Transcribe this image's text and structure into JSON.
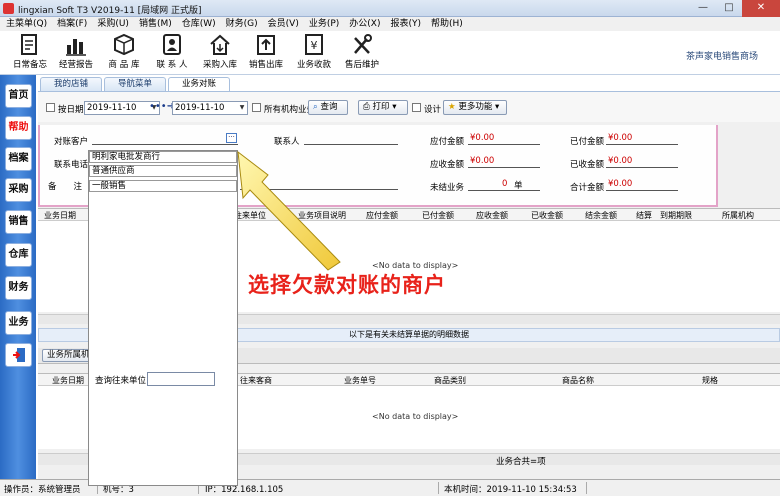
{
  "window": {
    "title": "lingxian Soft T3 V2019-11 [局域网 正式版]",
    "minimize": "—",
    "maximize": "□",
    "close": "✕"
  },
  "menu": [
    "主菜单(Q)",
    "档案(F)",
    "采购(U)",
    "销售(M)",
    "仓库(W)",
    "财务(G)",
    "会员(V)",
    "业务(P)",
    "办公(X)",
    "报表(Y)",
    "帮助(H)"
  ],
  "toolbar": [
    {
      "label": "日常备忘",
      "icon": "memo-icon"
    },
    {
      "label": "经营报告",
      "icon": "bar-chart-icon"
    },
    {
      "label": "商 品 库",
      "icon": "box-icon"
    },
    {
      "label": "联 系 人",
      "icon": "contact-card-icon"
    },
    {
      "label": "采购入库",
      "icon": "house-arrow-icon"
    },
    {
      "label": "销售出库",
      "icon": "upload-icon"
    },
    {
      "label": "业务收款",
      "icon": "yen-doc-icon"
    },
    {
      "label": "售后维护",
      "icon": "tools-icon"
    }
  ],
  "company": "茶声家电销售商场",
  "leftnav": [
    {
      "label": "首页",
      "red": false
    },
    {
      "label": "帮助",
      "red": true
    },
    {
      "label": "档案",
      "red": false
    },
    {
      "label": "采购",
      "red": false
    },
    {
      "label": "销售",
      "red": false
    },
    {
      "label": "仓库",
      "red": false
    },
    {
      "label": "财务",
      "red": false
    },
    {
      "label": "业务",
      "red": false
    }
  ],
  "tabs": [
    "我的店铺",
    "导航菜单",
    "业务对账"
  ],
  "filter": {
    "by_date": "按日期",
    "date_from": "2019-11-10",
    "date_to": "2019-11-10",
    "all_org": "所有机构业务",
    "query": "查询",
    "print": "打印",
    "design": "设计",
    "more": "更多功能"
  },
  "form": {
    "customer_label": "对账客户",
    "contact_label": "联系人",
    "phone_label": "联系电话",
    "remark_label": "备　　注",
    "payable_label": "应付金额",
    "paid_label": "已付金额",
    "receivable_label": "应收金额",
    "received_label": "已收金额",
    "pending_label": "未结业务",
    "total_label": "合计金额",
    "payable": "¥0.00",
    "paid": "¥0.00",
    "receivable": "¥0.00",
    "received": "¥0.00",
    "pending_count": "0",
    "pending_unit": "单",
    "total": "¥0.00"
  },
  "dropdown": {
    "items": [
      "明利家电批发商行",
      "普通供应商",
      "一般销售"
    ],
    "search_label": "查询往来单位"
  },
  "grid1": {
    "columns": [
      "业务日期",
      "往来单位",
      "业务项目说明",
      "应付金额",
      "已付金额",
      "应收金额",
      "已收金额",
      "结余金额",
      "结算",
      "到期期限",
      "所属机构"
    ],
    "empty": "<No data to display>"
  },
  "section_title": "以下是有关未结算单据的明细数据",
  "group_label": "业务所属机构",
  "grid2": {
    "columns": [
      "业务日期",
      "往来客商",
      "业务单号",
      "商品类别",
      "商品名称",
      "规格"
    ],
    "empty": "<No data to display>",
    "summary": "业务合共=项"
  },
  "annotation": "选择欠款对账的商户",
  "status": {
    "operator": "操作员：系统管理员",
    "machine": "机号：3",
    "ip": "IP：192.168.1.105",
    "time": "本机时间：2019-11-10 15:34:53"
  }
}
